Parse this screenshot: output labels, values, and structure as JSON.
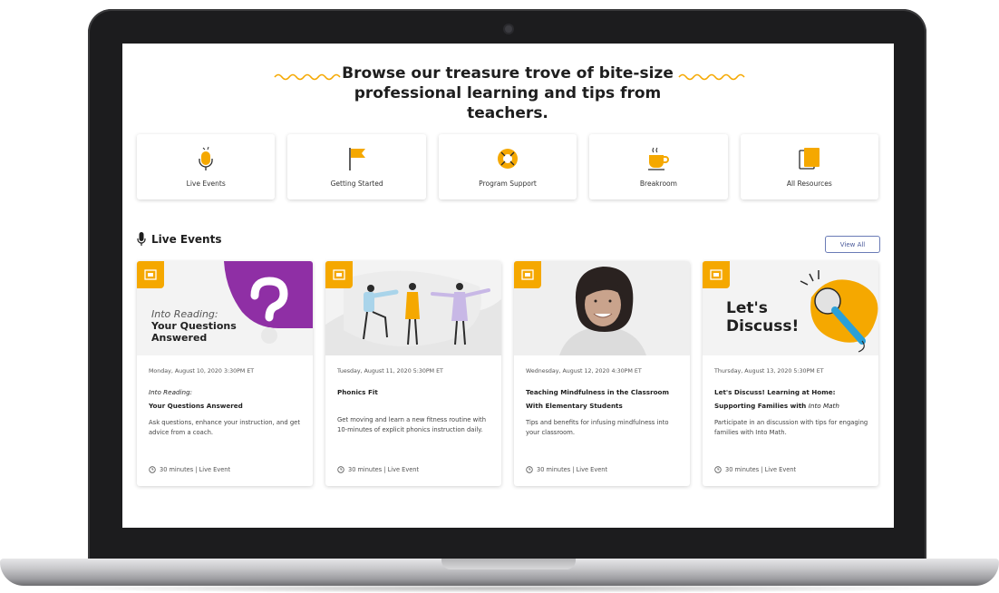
{
  "headline": "Browse our treasure trove of bite-size professional learning and tips from teachers.",
  "colors": {
    "accent": "#f5a800",
    "purple": "#8f2fa5",
    "link": "#4a5a9a"
  },
  "categories": [
    {
      "label": "Live Events",
      "icon": "microphone-icon"
    },
    {
      "label": "Getting Started",
      "icon": "flag-icon"
    },
    {
      "label": "Program Support",
      "icon": "lifebuoy-icon"
    },
    {
      "label": "Breakroom",
      "icon": "coffee-cup-icon"
    },
    {
      "label": "All Resources",
      "icon": "folder-stack-icon"
    }
  ],
  "section": {
    "title": "Live Events",
    "view_all": "View All"
  },
  "events": [
    {
      "media_text_italic": "Into Reading:",
      "media_text_bold_1": "Your Questions",
      "media_text_bold_2": "Answered",
      "date": "Monday, August 10, 2020 3:30PM ET",
      "title_italic": "Into Reading:",
      "title": "Your Questions Answered",
      "description": "Ask questions, enhance your instruction, and get advice from a coach.",
      "meta": "30 minutes | Live Event"
    },
    {
      "date": "Tuesday, August 11, 2020 5:30PM ET",
      "title": "Phonics Fit",
      "description": "Get moving and learn a new fitness routine with 10-minutes of explicit phonics instruction daily.",
      "meta": "30 minutes | Live Event"
    },
    {
      "date": "Wednesday, August 12, 2020 4:30PM ET",
      "title": "Teaching Mindfulness in the Classroom With Elementary Students",
      "description": "Tips and benefits for infusing mindfulness into your classroom.",
      "meta": "30 minutes | Live Event"
    },
    {
      "media_text_1": "Let's",
      "media_text_2": "Discuss!",
      "date": "Thursday, August 13, 2020 5:30PM ET",
      "title": "Let's Discuss! Learning at Home: Supporting Families with",
      "title_italic": "Into Math",
      "description": "Participate in an discussion with tips for engaging families with Into Math.",
      "meta": "30 minutes | Live Event"
    }
  ]
}
